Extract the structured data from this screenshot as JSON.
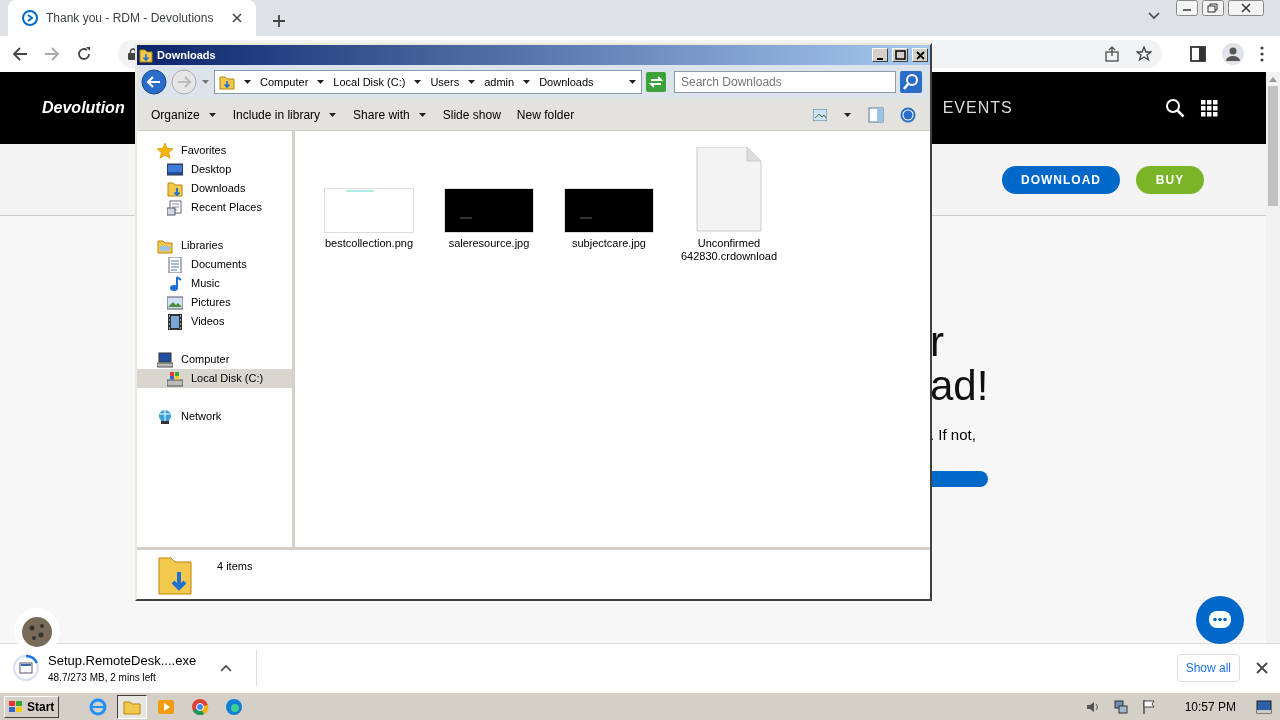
{
  "browser": {
    "tab_title": "Thank you - RDM - Devolutions"
  },
  "website": {
    "logo": "Devolution",
    "nav_item": "EVENTS",
    "buttons": [
      {
        "label": "DOWNLOAD",
        "kind": "primary"
      },
      {
        "label": "BUY",
        "kind": "secondary"
      }
    ],
    "hero": {
      "heading_lines": [
        "r",
        "ad!"
      ],
      "text": ". If not,"
    }
  },
  "explorer": {
    "title": "Downloads",
    "breadcrumb": [
      "Computer",
      "Local Disk (C:)",
      "Users",
      "admin",
      "Downloads"
    ],
    "search": {
      "placeholder": "Search Downloads"
    },
    "toolbar": [
      {
        "label": "Organize",
        "dropdown": true
      },
      {
        "label": "Include in library",
        "dropdown": true
      },
      {
        "label": "Share with",
        "dropdown": true
      },
      {
        "label": "Slide show",
        "dropdown": false
      },
      {
        "label": "New folder",
        "dropdown": false
      }
    ],
    "sidebar": [
      {
        "label": "Favorites",
        "kind": "star",
        "selected": false,
        "children": [
          {
            "label": "Desktop",
            "kind": "desktop",
            "selected": false
          },
          {
            "label": "Downloads",
            "kind": "downloads",
            "selected": false
          },
          {
            "label": "Recent Places",
            "kind": "recent",
            "selected": false
          }
        ]
      },
      {
        "label": "Libraries",
        "kind": "libraries",
        "selected": false,
        "children": [
          {
            "label": "Documents",
            "kind": "documents",
            "selected": false
          },
          {
            "label": "Music",
            "kind": "music",
            "selected": false
          },
          {
            "label": "Pictures",
            "kind": "pictures",
            "selected": false
          },
          {
            "label": "Videos",
            "kind": "videos",
            "selected": false
          }
        ]
      },
      {
        "label": "Computer",
        "kind": "computer",
        "selected": false,
        "children": [
          {
            "label": "Local Disk (C:)",
            "kind": "drive",
            "selected": true
          }
        ]
      },
      {
        "label": "Network",
        "kind": "network",
        "selected": false
      }
    ],
    "files": [
      {
        "name": "bestcollection.png",
        "kind": "light-image"
      },
      {
        "name": "saleresource.jpg",
        "kind": "dark-image"
      },
      {
        "name": "subjectcare.jpg",
        "kind": "dark-image"
      },
      {
        "name": "Unconfirmed 642830.crdownload",
        "kind": "document"
      }
    ],
    "status": "4 items"
  },
  "download_bar": {
    "file": "Setup.RemoteDesk....exe",
    "progress": "48.7/273 MB, 2 mins left",
    "level": 0.18,
    "show_all": "Show all"
  },
  "taskbar": {
    "start": "Start",
    "time": "10:57 PM"
  }
}
